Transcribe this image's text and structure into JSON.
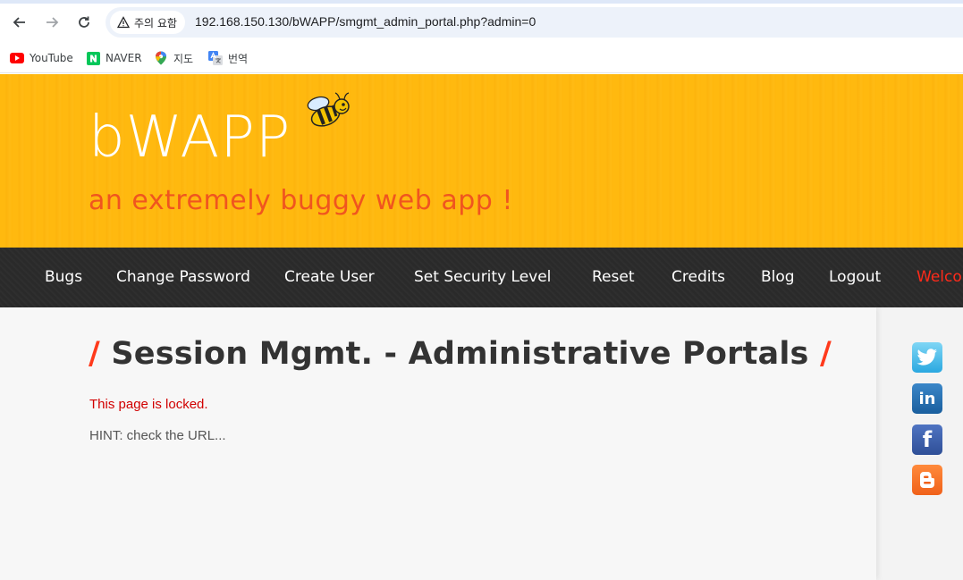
{
  "browser": {
    "security_chip": "주의 요함",
    "url": "192.168.150.130/bWAPP/smgmt_admin_portal.php?admin=0",
    "bookmarks": [
      {
        "label": "YouTube",
        "icon": "youtube-icon"
      },
      {
        "label": "NAVER",
        "icon": "naver-icon"
      },
      {
        "label": "지도",
        "icon": "maps-icon"
      },
      {
        "label": "번역",
        "icon": "translate-icon"
      }
    ]
  },
  "site": {
    "logo": "bWAPP",
    "tagline": "an extremely buggy web app !"
  },
  "menu": {
    "items": [
      "Bugs",
      "Change Password",
      "Create User",
      "Set Security Level",
      "Reset",
      "Credits",
      "Blog",
      "Logout"
    ],
    "welcome": "Welco"
  },
  "page": {
    "title": "Session Mgmt. - Administrative Portals",
    "slash": "/",
    "locked_message": "This page is locked.",
    "hint": "HINT: check the URL..."
  },
  "social": [
    "twitter-icon",
    "linkedin-icon",
    "facebook-icon",
    "blogger-icon"
  ],
  "colors": {
    "header_bg": "#ffb90f",
    "tagline": "#f0551f",
    "menu_bg": "#2b2b2b",
    "welcome": "#ff2a1a",
    "locked": "#d10000"
  }
}
